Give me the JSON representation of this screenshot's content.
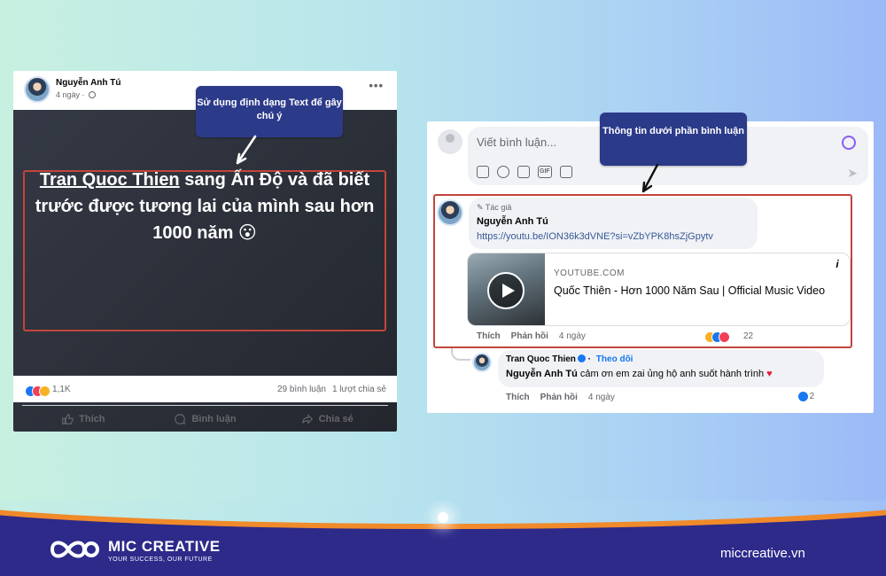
{
  "post": {
    "author": "Nguyễn Anh Tú",
    "time": "4 ngày",
    "more": "•••",
    "text_link": "Tran Quoc Thien",
    "text_rest": " sang Ấn Độ và đã biết trước được tương lai của mình sau hơn 1000 năm 😮",
    "reactions": "1,1K",
    "comments": "29 bình luận",
    "shares": "1 lượt chia sẻ",
    "actions": {
      "like": "Thích",
      "comment": "Bình luận",
      "share": "Chia sẻ"
    }
  },
  "callouts": {
    "left": "Sử dụng định dạng Text để gây chú ý",
    "right": "Thông tin dưới phần bình luận"
  },
  "comments": {
    "input_placeholder": "Viết bình luận...",
    "gif_label": "GIF",
    "main": {
      "badge": "Tác giả",
      "author": "Nguyễn Anh Tú",
      "link": "https://youtu.be/ION36k3dVNE?si=vZbYPK8hsZjGpytv",
      "preview_domain": "YOUTUBE.COM",
      "preview_title": "Quốc Thiên - Hơn 1000 Năm Sau | Official Music Video",
      "like": "Thích",
      "reply": "Phản hồi",
      "time": "4 ngày",
      "reaction_count": "22"
    },
    "reply": {
      "author": "Tran Quoc Thien",
      "follow": "Theo dõi",
      "mention": "Nguyễn Anh Tú",
      "text": " cảm ơn em zai ủng hộ anh suốt hành trình",
      "heart": "♥",
      "like": "Thích",
      "reply": "Phản hồi",
      "time": "4 ngày",
      "like_count": "2"
    }
  },
  "brand": {
    "name": "MIC CREATIVE",
    "slogan": "YOUR SUCCESS, OUR FUTURE",
    "site": "miccreative.vn"
  },
  "colors": {
    "facebook_blue": "#1877f2",
    "highlight_red": "#c2453c",
    "callout_navy": "#2c3a8a",
    "brand_navy": "#2d2a8a",
    "brand_orange": "#f08a2a"
  }
}
